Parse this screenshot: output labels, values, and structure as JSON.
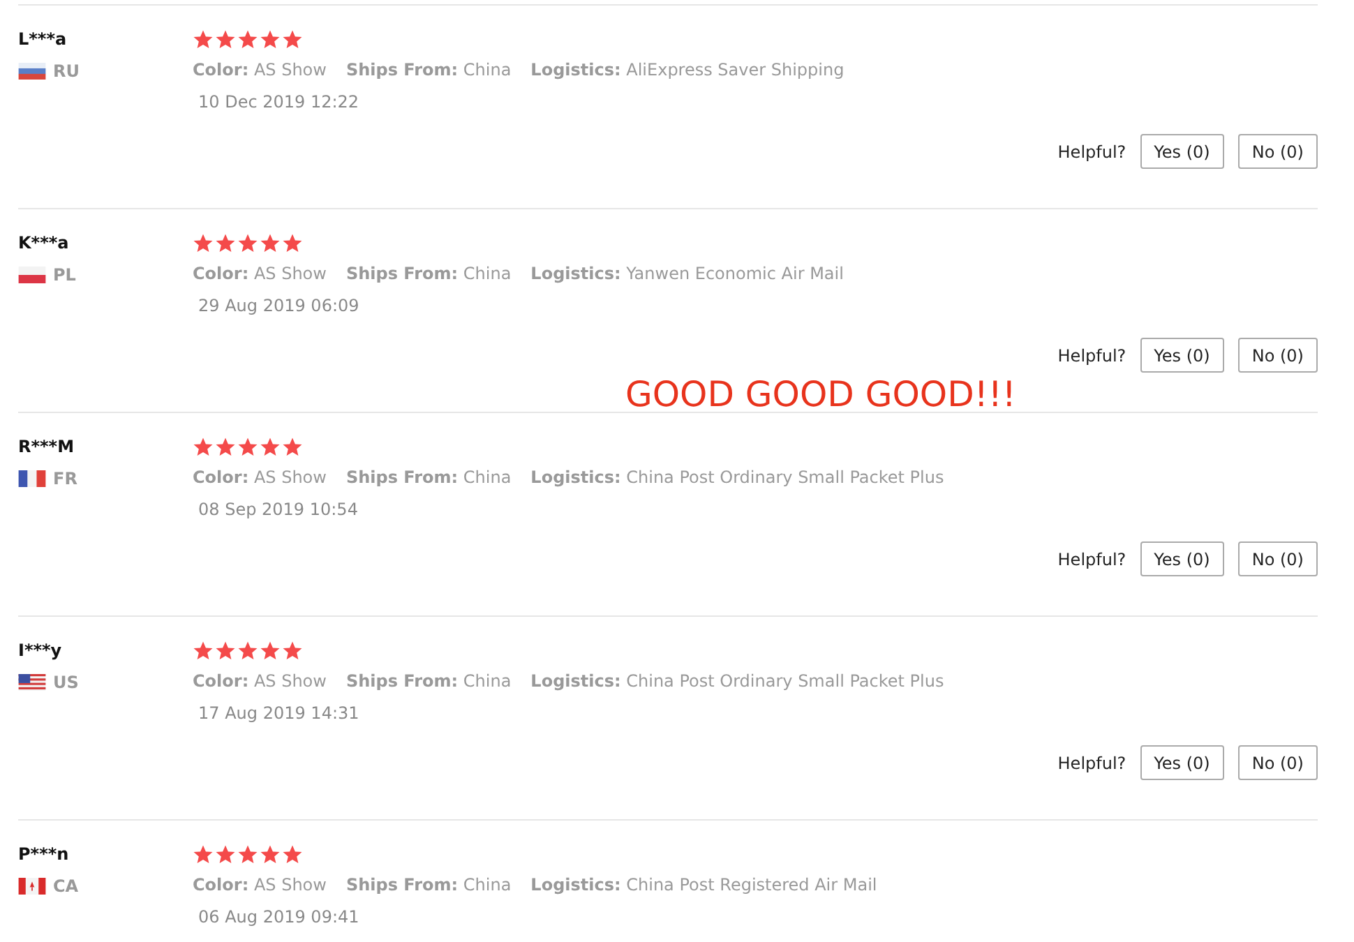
{
  "reviews": [
    {
      "name": "L***a",
      "kind": "ru",
      "country": "RU",
      "stars": 5,
      "details": [
        {
          "label": "Color:",
          "value": "AS Show"
        },
        {
          "label": "Ships From:",
          "value": "China"
        },
        {
          "label": "Logistics:",
          "value": "AliExpress Saver Shipping"
        }
      ],
      "date": "10 Dec 2019 12:22",
      "helpful_label": "Helpful?",
      "buttons": [
        "Yes (0)",
        "No (0)"
      ]
    },
    {
      "name": "K***a",
      "kind": "pl",
      "country": "PL",
      "stars": 5,
      "details": [
        {
          "label": "Color:",
          "value": "AS Show"
        },
        {
          "label": "Ships From:",
          "value": "China"
        },
        {
          "label": "Logistics:",
          "value": "Yanwen Economic Air Mail"
        }
      ],
      "date": "29 Aug 2019 06:09",
      "helpful_label": "Helpful?",
      "buttons": [
        "Yes (0)",
        "No (0)"
      ]
    },
    {
      "name": "R***M",
      "kind": "fr",
      "country": "FR",
      "stars": 5,
      "details": [
        {
          "label": "Color:",
          "value": "AS Show"
        },
        {
          "label": "Ships From:",
          "value": "China"
        },
        {
          "label": "Logistics:",
          "value": "China Post Ordinary Small Packet Plus"
        }
      ],
      "date": "08 Sep 2019 10:54",
      "helpful_label": "Helpful?",
      "buttons": [
        "Yes (0)",
        "No (0)"
      ]
    },
    {
      "name": "I***y",
      "kind": "us",
      "country": "US",
      "stars": 5,
      "details": [
        {
          "label": "Color:",
          "value": "AS Show"
        },
        {
          "label": "Ships From:",
          "value": "China"
        },
        {
          "label": "Logistics:",
          "value": "China Post Ordinary Small Packet Plus"
        }
      ],
      "date": "17 Aug 2019 14:31",
      "helpful_label": "Helpful?",
      "buttons": [
        "Yes (0)",
        "No (0)"
      ]
    },
    {
      "name": "P***n",
      "kind": "ca",
      "country": "CA",
      "stars": 5,
      "details": [
        {
          "label": "Color:",
          "value": "AS Show"
        },
        {
          "label": "Ships From:",
          "value": "China"
        },
        {
          "label": "Logistics:",
          "value": "China Post Registered Air Mail"
        }
      ],
      "date": "06 Aug 2019 09:41"
    }
  ],
  "overlay_caption": "GOOD GOOD GOOD!!!"
}
